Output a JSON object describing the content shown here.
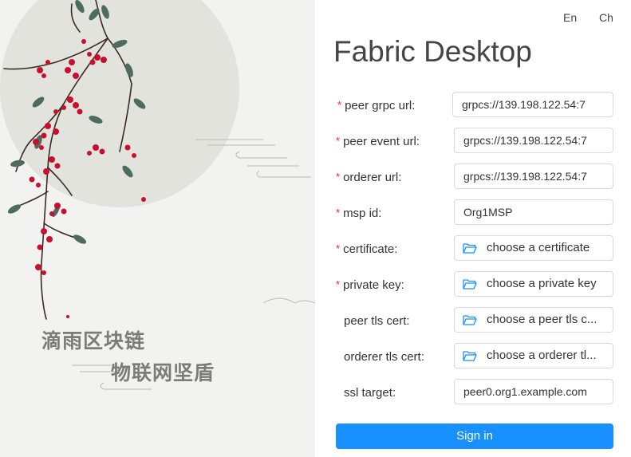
{
  "art": {
    "slogan_line1": "滴雨区块链",
    "slogan_line2": "物联网坚盾"
  },
  "lang": {
    "en": "En",
    "ch": "Ch"
  },
  "title": "Fabric Desktop",
  "form": {
    "peer_grpc_url": {
      "label": "peer grpc url:",
      "required": true,
      "value": "grpcs://139.198.122.54:7"
    },
    "peer_event_url": {
      "label": "peer event url:",
      "required": true,
      "value": "grpcs://139.198.122.54:7"
    },
    "orderer_url": {
      "label": "orderer url:",
      "required": true,
      "value": "grpcs://139.198.122.54:7"
    },
    "msp_id": {
      "label": "msp id:",
      "required": true,
      "value": "Org1MSP"
    },
    "certificate": {
      "label": "certificate:",
      "required": true,
      "button": "choose a certificate"
    },
    "private_key": {
      "label": "private key:",
      "required": true,
      "button": "choose a private key"
    },
    "peer_tls_cert": {
      "label": "peer tls cert:",
      "required": false,
      "button": "choose a peer tls c..."
    },
    "orderer_tls_cert": {
      "label": "orderer tls cert:",
      "required": false,
      "button": "choose a orderer tl..."
    },
    "ssl_target": {
      "label": "ssl target:",
      "required": false,
      "value": "peer0.org1.example.com"
    },
    "required_mark": "*",
    "submit": "Sign in"
  },
  "icons": {
    "file": "folder-open-icon"
  },
  "colors": {
    "primary": "#1890ff",
    "required": "#f5222d",
    "berry": "#c8102e"
  }
}
